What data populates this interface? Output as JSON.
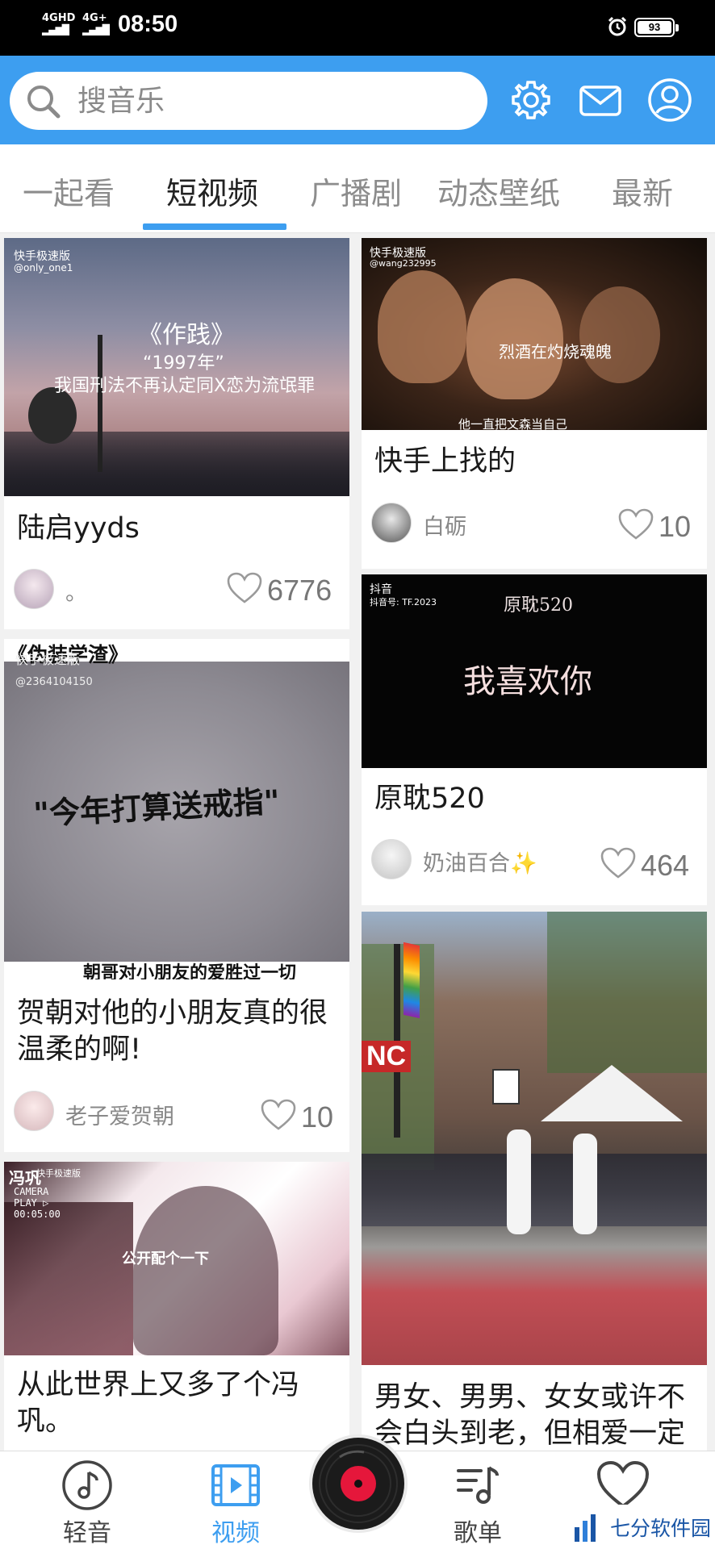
{
  "status": {
    "net1": "4GHD",
    "net2": "4G+",
    "time": "08:50",
    "battery": "93"
  },
  "search": {
    "placeholder": "搜音乐"
  },
  "tabs": [
    "一起看",
    "短视频",
    "广播剧",
    "动态壁纸",
    "最新"
  ],
  "active_tab": 1,
  "cards": [
    {
      "title": "陆启yyds",
      "user": "。",
      "likes": "6776",
      "thumb_texts": [
        "快手极速版",
        "@only_one1",
        "《作践》",
        "“1997年”",
        "我国刑法不再认定同X恋为流氓罪"
      ]
    },
    {
      "title": "快手上找的",
      "user": "白砺",
      "likes": "10",
      "thumb_texts": [
        "快手极速版",
        "@wang232995",
        "烈酒在灼烧魂魄",
        "他一直把文森当自己"
      ]
    },
    {
      "title": "原耽520",
      "user": "奶油百合✨",
      "likes": "464",
      "thumb_texts": [
        "抖音",
        "抖音号: TF.2023",
        "原耽520",
        "我喜欢你"
      ]
    },
    {
      "title": "贺朝对他的小朋友真的很温柔的啊!",
      "user": "老子爱贺朝",
      "likes": "10",
      "thumb_texts": [
        "《伪装学渣》",
        "快手极速版",
        "@2364104150",
        "\"今年打算送戒指\"",
        "朝哥对小朋友的爱胜过一切"
      ]
    },
    {
      "title": "从此世界上又多了个冯巩。",
      "thumb_texts": [
        "冯巩",
        "快手极速版",
        "CAMERA",
        "PLAY ▷",
        "00:05:00",
        "公开配个一下"
      ]
    },
    {
      "title": "男女、男男、女女或许不会白头到老，但相爱一定",
      "thumb_texts": [
        "NC"
      ]
    }
  ],
  "nav": [
    {
      "label": "轻音",
      "icon": "music-note-icon"
    },
    {
      "label": "视频",
      "icon": "video-icon"
    },
    {
      "label": "",
      "icon": "vinyl-disc-icon"
    },
    {
      "label": "歌单",
      "icon": "playlist-icon"
    },
    {
      "label": "",
      "icon": "heart-icon"
    }
  ],
  "watermark": "七分软件园",
  "colors": {
    "accent": "#3d9ef0",
    "header": "#3d9ef0",
    "disc_center": "#e5173b"
  }
}
